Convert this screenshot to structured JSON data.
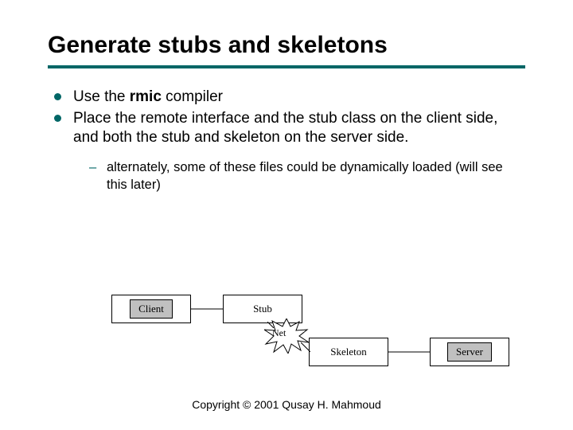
{
  "title": "Generate stubs and skeletons",
  "bullets": {
    "b1_pre": "Use the ",
    "b1_bold": "rmic",
    "b1_post": " compiler",
    "b2": "Place the remote interface and the stub class on the client side, and both the stub and skeleton on the server side.",
    "sub1": "alternately, some of these files could be dynamically loaded (will see this later)"
  },
  "diagram": {
    "client": "Client",
    "stub": "Stub",
    "net": "Net",
    "skeleton": "Skeleton",
    "server": "Server"
  },
  "footer": "Copyright © 2001 Qusay H. Mahmoud"
}
